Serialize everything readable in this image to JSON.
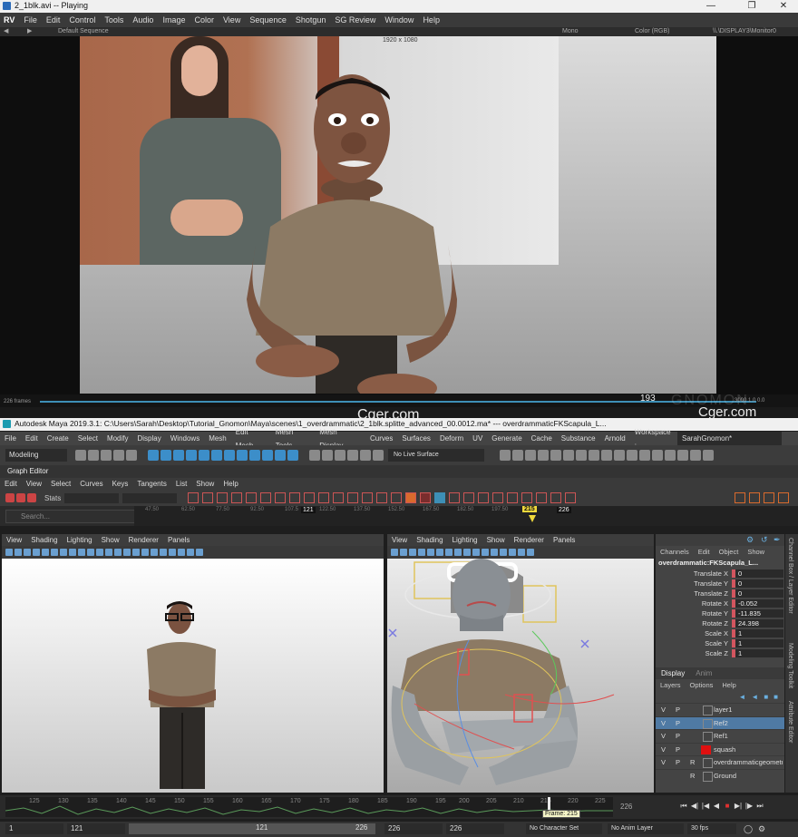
{
  "rv": {
    "title": "2_1blk.avi -- Playing",
    "logo": "RV",
    "menu": [
      "File",
      "Edit",
      "Control",
      "Tools",
      "Audio",
      "Image",
      "Color",
      "View",
      "Sequence",
      "Shotgun",
      "SG Review",
      "Window",
      "Help"
    ],
    "toolbar": {
      "sequence": "Default Sequence",
      "mono": "Mono",
      "color": "Color (RGB)",
      "display": "\\\\.\\DISPLAY3\\Monitor0"
    },
    "resolution": "1920 x 1080",
    "frames_label": "226 frames",
    "current_frame": "193",
    "status_right": "3000 1.0 0.0"
  },
  "watermark": {
    "brand": "Cger.com",
    "gnomon": "GNOMON"
  },
  "maya": {
    "title": "Autodesk Maya 2019.3.1: C:\\Users\\Sarah\\Desktop\\Tutorial_Gnomon\\Maya\\scenes\\1_overdrammatic\\2_1blk.splitte_advanced_00.0012.ma*   ---   overdrammaticFKScapula_L...",
    "menu": [
      "File",
      "Edit",
      "Create",
      "Select",
      "Modify",
      "Display",
      "Windows",
      "Mesh",
      "Edit Mesh",
      "Mesh Tools",
      "Mesh Display",
      "Curves",
      "Surfaces",
      "Deform",
      "UV",
      "Generate",
      "Cache",
      "Substance",
      "Arnold"
    ],
    "workspace_label": "Workspace :",
    "workspace_value": "SarahGnomon*",
    "mode": "Modeling",
    "live_surface": "No Live Surface"
  },
  "graph_editor": {
    "title": "Graph Editor",
    "menu": [
      "Edit",
      "View",
      "Select",
      "Curves",
      "Keys",
      "Tangents",
      "List",
      "Show",
      "Help"
    ],
    "stats_label": "Stats",
    "search_placeholder": "Search...",
    "ruler_ticks": [
      "47.50",
      "62.50",
      "77.50",
      "92.50",
      "107.5",
      "121",
      "122.50",
      "137.50",
      "152.50",
      "167.50",
      "182.50",
      "197.50",
      "215",
      "226"
    ],
    "current": "215",
    "end": "226",
    "marker": "121"
  },
  "viewport_menu": [
    "View",
    "Shading",
    "Lighting",
    "Show",
    "Renderer",
    "Panels"
  ],
  "channel_box": {
    "menu": [
      "Channels",
      "Edit",
      "Object",
      "Show"
    ],
    "node": "overdrammatic:FKScapula_L...",
    "attributes": [
      {
        "label": "Translate X",
        "value": "0"
      },
      {
        "label": "Translate Y",
        "value": "0"
      },
      {
        "label": "Translate Z",
        "value": "0"
      },
      {
        "label": "Rotate X",
        "value": "-0.052"
      },
      {
        "label": "Rotate Y",
        "value": "-11.835"
      },
      {
        "label": "Rotate Z",
        "value": "24.398"
      },
      {
        "label": "Scale X",
        "value": "1"
      },
      {
        "label": "Scale Y",
        "value": "1"
      },
      {
        "label": "Scale Z",
        "value": "1"
      }
    ],
    "layer_tabs": [
      "Display",
      "Anim"
    ],
    "layer_menu": [
      "Layers",
      "Options",
      "Help"
    ],
    "layers": [
      {
        "v": "V",
        "p": "P",
        "r": "",
        "name": "layer1",
        "color": ""
      },
      {
        "v": "V",
        "p": "P",
        "r": "",
        "name": "Ref2",
        "color": ""
      },
      {
        "v": "V",
        "p": "P",
        "r": "",
        "name": "Ref1",
        "color": ""
      },
      {
        "v": "V",
        "p": "P",
        "r": "",
        "name": "squash",
        "color": "#e01010"
      },
      {
        "v": "V",
        "p": "P",
        "r": "R",
        "name": "overdrammaticgeometry",
        "color": ""
      },
      {
        "v": "",
        "p": "",
        "r": "R",
        "name": "Ground",
        "color": ""
      }
    ]
  },
  "side_tabs": [
    "Channel Box / Layer Editor",
    "Modeling Toolkit",
    "Attribute Editor"
  ],
  "time_slider": {
    "ticks": [
      "125",
      "130",
      "135",
      "140",
      "145",
      "150",
      "155",
      "160",
      "165",
      "170",
      "175",
      "180",
      "185",
      "190",
      "195",
      "200",
      "205",
      "210",
      "215",
      "220",
      "225"
    ],
    "end": "226",
    "tooltip": "Frame: 215"
  },
  "range": {
    "start": "1",
    "inner_start": "121",
    "slider_start": "121",
    "slider_end": "226",
    "inner_end": "226",
    "end": "226",
    "character_set": "No Character Set",
    "anim_layer": "No Anim Layer",
    "fps": "30 fps"
  }
}
